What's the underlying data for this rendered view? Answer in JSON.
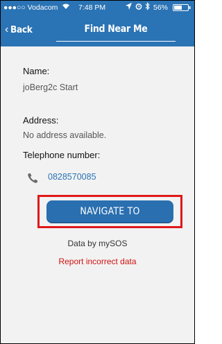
{
  "status_bar": {
    "carrier": "●●●○○ Vodacom",
    "wifi_icon": "wifi-icon",
    "time": "7:48 PM",
    "battery_percent": "56%"
  },
  "nav_bar": {
    "back_label": "Back",
    "back_chevron": "‹",
    "title": "Find Near Me"
  },
  "details": {
    "name_label": "Name:",
    "name_value": "joBerg2c Start",
    "address_label": "Address:",
    "address_value": "No address available.",
    "telephone_label": "Telephone number:",
    "telephone_value": "0828570085"
  },
  "actions": {
    "navigate_label": "NAVIGATE TO",
    "credit": "Data by mySOS",
    "report_label": "Report incorrect data"
  },
  "colors": {
    "accent": "#2a73b4",
    "highlight": "#e01818",
    "report": "#d01010"
  }
}
